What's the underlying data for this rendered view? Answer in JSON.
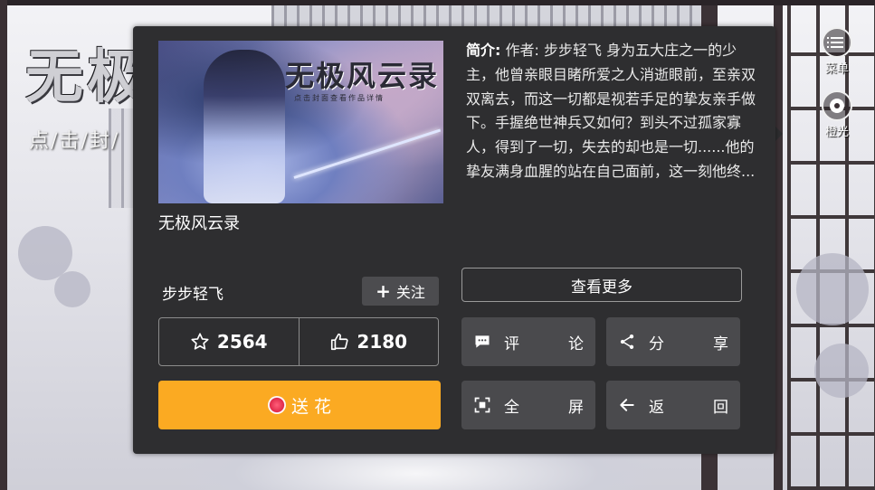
{
  "background": {
    "title_art": "无极",
    "hint": "点/击/封/"
  },
  "side_menu": {
    "menu_label": "菜单",
    "gallery_label": "橙光"
  },
  "book": {
    "cover_title": "无极风云录",
    "cover_subtitle": "点击封面查看作品详情",
    "title": "无极风云录",
    "synopsis_label": "简介:",
    "synopsis_text": "作者: 步步轻飞 身为五大庄之一的少主，他曾亲眼目睹所爱之人消逝眼前，至亲双双离去，而这一切都是视若手足的挚友亲手做下。手握绝世神兵又如何？到头不过孤家寡人，得到了一切，失去的却也是一切......他的挚友满身血腥的站在自己面前，这一刻他终..."
  },
  "author": {
    "name": "步步轻飞",
    "follow_label": "关注"
  },
  "more_label": "查看更多",
  "stats": {
    "favorites": "2564",
    "likes": "2180"
  },
  "send_flower_label": "送 花",
  "actions": {
    "comment": [
      "评",
      "论"
    ],
    "share": [
      "分",
      "享"
    ],
    "fullscreen": [
      "全",
      "屏"
    ],
    "back": [
      "返",
      "回"
    ]
  },
  "colors": {
    "panel_bg": "#2e2e30",
    "button_bg": "#4a4a4d",
    "accent_orange": "#fbaa22"
  }
}
